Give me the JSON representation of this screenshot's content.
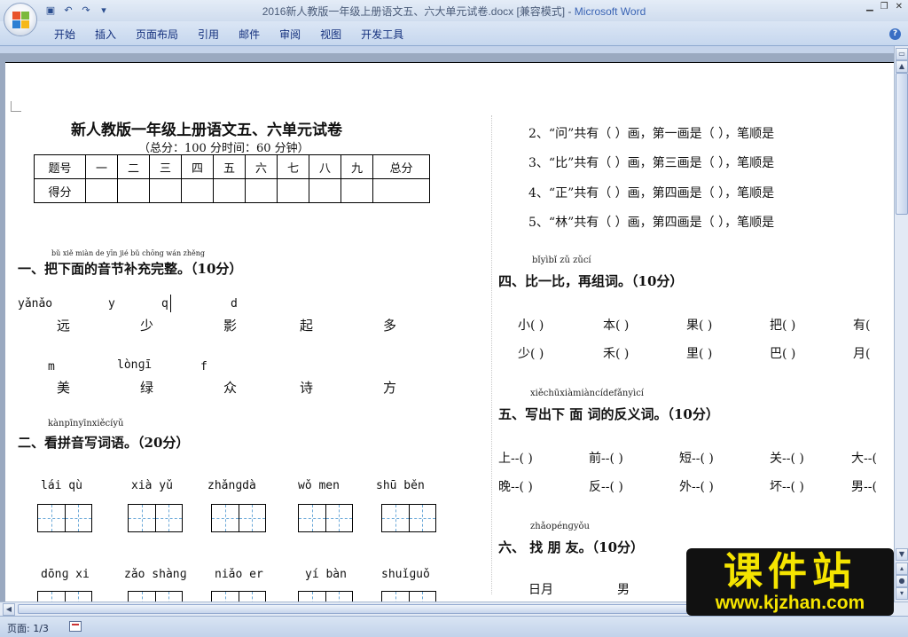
{
  "window": {
    "title": "2016新人教版一年级上册语文五、六大单元试卷.docx [兼容模式] - ",
    "app_name": "Microsoft Word"
  },
  "quick_access": [
    "save-icon",
    "undo-icon",
    "redo-icon",
    "customize-icon"
  ],
  "ribbon": {
    "tabs": [
      "开始",
      "插入",
      "页面布局",
      "引用",
      "邮件",
      "审阅",
      "视图",
      "开发工具"
    ]
  },
  "doc": {
    "title": "新人教版一年级上册语文五、六单元试卷",
    "subtitle": "（总分：100 分时间：60 分钟）",
    "score_table": {
      "row1": [
        "题号",
        "一",
        "二",
        "三",
        "四",
        "五",
        "六",
        "七",
        "八",
        "九",
        "总分"
      ],
      "row2_label": "得分"
    },
    "s1": {
      "ruby": "bǔ xiě miàn de yīn jié bǔ chōng wán zhěng",
      "heading": "一、把下面的音节补充完整。（10分）",
      "row1_py": [
        "yǎnǎo",
        "y",
        "q",
        "d"
      ],
      "row1_ch": [
        "远",
        "少",
        "影",
        "起",
        "多"
      ],
      "row2_py": [
        "m",
        "lònɡī",
        "f"
      ],
      "row2_ch": [
        "美",
        "绿",
        "众",
        "诗",
        "方"
      ]
    },
    "s2": {
      "ruby": "kànpīnyīnxiěcíyǔ",
      "heading": "二、看拼音写词语。（20分）",
      "row1": [
        "lái qù",
        "xià yǔ",
        "zhǎnɡdà",
        "wǒ men",
        "shū běn"
      ],
      "row2": [
        "dōnɡ xi",
        "zǎo shànɡ",
        "niǎo er",
        "yí bàn",
        "shuǐɡuǒ"
      ]
    },
    "s3": {
      "lines": [
        "2、“问”共有（   ）画，第一画是（   ），笔顺是",
        "3、“比”共有（   ）画，第三画是（   ），笔顺是",
        "4、“正”共有（   ）画，第四画是（   ），笔顺是",
        "5、“林”共有（   ）画，第四画是（   ），笔顺是"
      ]
    },
    "s4": {
      "ruby": "bǐyìbǐ   zǔ zǔcí",
      "heading": "四、比一比，再组词。（10分）",
      "row1": [
        "小(    )",
        "本(    )",
        "果(    )",
        "把(    )",
        "有("
      ],
      "row2": [
        "少(    )",
        "禾(    )",
        "里(    )",
        "巴(    )",
        "月("
      ]
    },
    "s5": {
      "ruby": "xiěchūxiàmiàncídefǎnyìcí",
      "heading": "五、写出下 面 词的反义词。（10分）",
      "row1": [
        "上--(   )",
        "前--(   )",
        "短--(   )",
        "关--(   )",
        "大--("
      ],
      "row2": [
        "晚--(   )",
        "反--(   )",
        "外--(   )",
        "坏--(   )",
        "男--("
      ]
    },
    "s6": {
      "ruby": "zhǎopénɡyǒu",
      "heading": "六、 找 朋 友。（10分）",
      "row1": [
        "日月",
        "男"
      ]
    }
  },
  "status": {
    "page": "页面: 1/3"
  },
  "watermark": {
    "title": "课件站",
    "url": "www.kjzhan.com"
  }
}
